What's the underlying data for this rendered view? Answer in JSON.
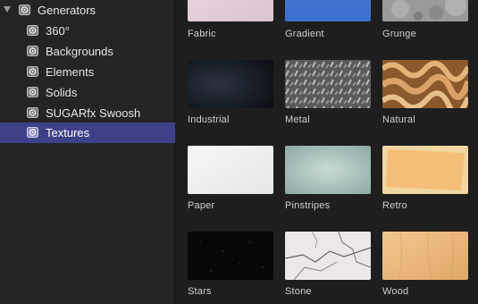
{
  "sidebar": {
    "parent": {
      "label": "Generators"
    },
    "items": [
      {
        "label": "360°"
      },
      {
        "label": "Backgrounds"
      },
      {
        "label": "Elements"
      },
      {
        "label": "Solids"
      },
      {
        "label": "SUGARfx Swoosh"
      },
      {
        "label": "Textures",
        "selected": true
      }
    ]
  },
  "browser": {
    "tiles": [
      {
        "label": "Fabric",
        "icon": "fabric-thumbnail"
      },
      {
        "label": "Gradient",
        "icon": "gradient-thumbnail"
      },
      {
        "label": "Grunge",
        "icon": "grunge-thumbnail"
      },
      {
        "label": "Industrial",
        "icon": "industrial-thumbnail"
      },
      {
        "label": "Metal",
        "icon": "metal-thumbnail"
      },
      {
        "label": "Natural",
        "icon": "natural-thumbnail"
      },
      {
        "label": "Paper",
        "icon": "paper-thumbnail"
      },
      {
        "label": "Pinstripes",
        "icon": "pinstripes-thumbnail"
      },
      {
        "label": "Retro",
        "icon": "retro-thumbnail"
      },
      {
        "label": "Stars",
        "icon": "stars-thumbnail"
      },
      {
        "label": "Stone",
        "icon": "stone-thumbnail"
      },
      {
        "label": "Wood",
        "icon": "wood-thumbnail"
      }
    ]
  },
  "colors": {
    "selection": "#3d4288",
    "sidebar_bg": "#242424",
    "browser_bg": "#1e1e1e"
  }
}
